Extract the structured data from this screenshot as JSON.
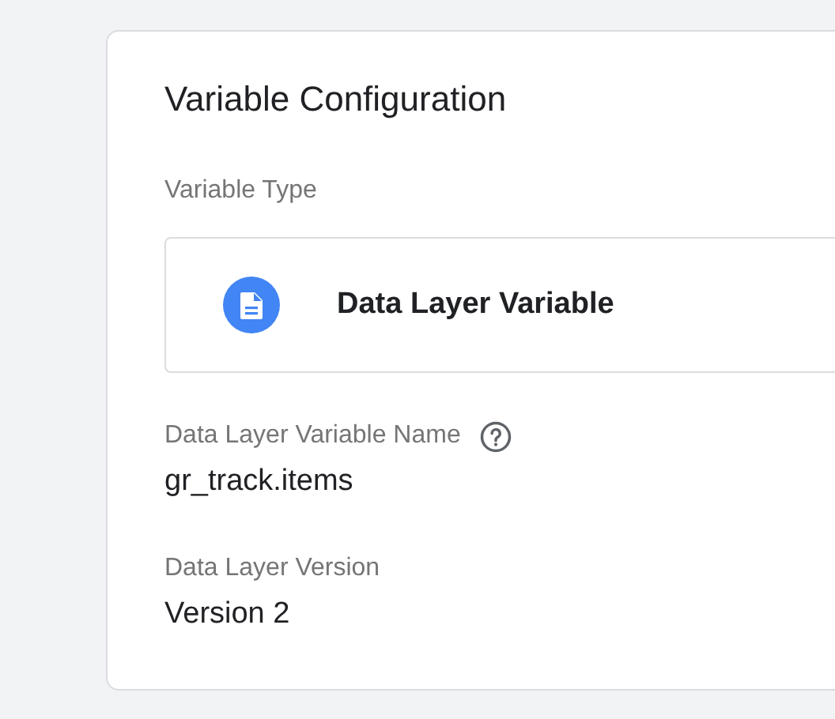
{
  "card": {
    "title": "Variable Configuration"
  },
  "variable_type": {
    "label": "Variable Type",
    "value": "Data Layer Variable"
  },
  "fields": [
    {
      "label": "Data Layer Variable Name",
      "help": true,
      "value": "gr_track.items"
    },
    {
      "label": "Data Layer Version",
      "help": false,
      "value": "Version 2"
    }
  ]
}
